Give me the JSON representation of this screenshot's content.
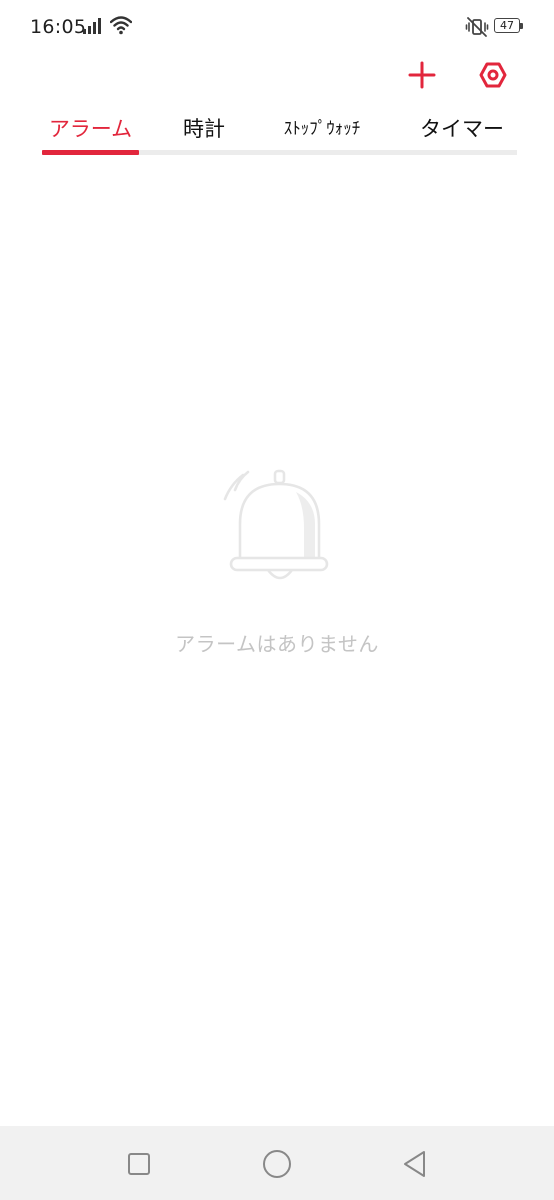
{
  "status_bar": {
    "time": "16:05",
    "battery_level": "47",
    "icons": [
      "signal-icon",
      "wifi-icon",
      "vibrate-off-icon",
      "battery-icon"
    ]
  },
  "toolbar": {
    "add_icon": "plus-icon",
    "settings_icon": "settings-icon",
    "accent_color": "#e2263c"
  },
  "tabs": [
    {
      "label": "アラーム",
      "active": true
    },
    {
      "label": "時計",
      "active": false
    },
    {
      "label": "ｽﾄｯﾌﾟｳｫｯﾁ",
      "active": false
    },
    {
      "label": "タイマー",
      "active": false
    }
  ],
  "empty_state": {
    "icon": "bell-icon",
    "message": "アラームはありません"
  },
  "nav_bar": {
    "icons": [
      "recents-icon",
      "home-icon",
      "back-icon"
    ]
  }
}
